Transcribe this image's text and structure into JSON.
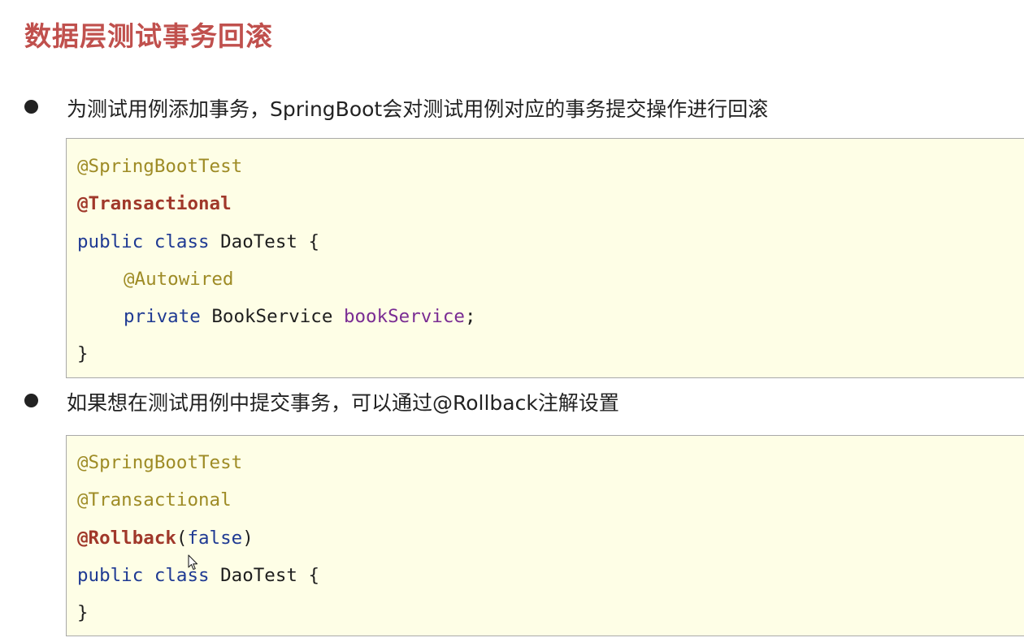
{
  "title": "数据层测试事务回滚",
  "bullets": [
    {
      "text": "为测试用例添加事务，SpringBoot会对测试用例对应的事务提交操作进行回滚",
      "code": {
        "line1": "@SpringBootTest",
        "line2": "@Transactional",
        "line3": {
          "kw1": "public",
          "kw2": "class",
          "name": "DaoTest",
          "brace": "{"
        },
        "line4": "@Autowired",
        "line5": {
          "kw": "private",
          "type": "BookService",
          "field": "bookService",
          "semi": ";"
        },
        "line6": "}"
      }
    },
    {
      "text": "如果想在测试用例中提交事务，可以通过@Rollback注解设置",
      "code": {
        "line1": "@SpringBootTest",
        "line2": "@Transactional",
        "line3": {
          "ann": "@Rollback",
          "open": "(",
          "value": "false",
          "close": ")"
        },
        "line4": {
          "kw1": "public",
          "kw2": "class",
          "name": "DaoTest",
          "brace": "{"
        },
        "line5": "}"
      }
    }
  ],
  "colors": {
    "title": "#c0504d",
    "code_background": "#fefee6",
    "annotation": "#9e8b25",
    "annotation_bold": "#a0382a",
    "keyword": "#1f3a93",
    "field": "#7a2c93"
  },
  "icons": {
    "cursor": "mouse-pointer-icon",
    "bullet": "bullet-dot-icon"
  }
}
